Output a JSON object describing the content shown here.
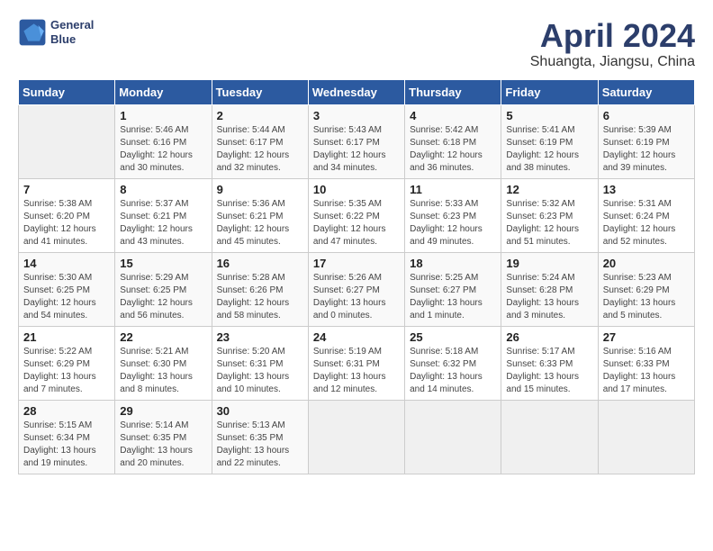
{
  "header": {
    "logo_line1": "General",
    "logo_line2": "Blue",
    "title": "April 2024",
    "subtitle": "Shuangta, Jiangsu, China"
  },
  "weekdays": [
    "Sunday",
    "Monday",
    "Tuesday",
    "Wednesday",
    "Thursday",
    "Friday",
    "Saturday"
  ],
  "weeks": [
    [
      {
        "day": "",
        "sunrise": "",
        "sunset": "",
        "daylight": ""
      },
      {
        "day": "1",
        "sunrise": "5:46 AM",
        "sunset": "6:16 PM",
        "daylight": "12 hours and 30 minutes."
      },
      {
        "day": "2",
        "sunrise": "5:44 AM",
        "sunset": "6:17 PM",
        "daylight": "12 hours and 32 minutes."
      },
      {
        "day": "3",
        "sunrise": "5:43 AM",
        "sunset": "6:17 PM",
        "daylight": "12 hours and 34 minutes."
      },
      {
        "day": "4",
        "sunrise": "5:42 AM",
        "sunset": "6:18 PM",
        "daylight": "12 hours and 36 minutes."
      },
      {
        "day": "5",
        "sunrise": "5:41 AM",
        "sunset": "6:19 PM",
        "daylight": "12 hours and 38 minutes."
      },
      {
        "day": "6",
        "sunrise": "5:39 AM",
        "sunset": "6:19 PM",
        "daylight": "12 hours and 39 minutes."
      }
    ],
    [
      {
        "day": "7",
        "sunrise": "5:38 AM",
        "sunset": "6:20 PM",
        "daylight": "12 hours and 41 minutes."
      },
      {
        "day": "8",
        "sunrise": "5:37 AM",
        "sunset": "6:21 PM",
        "daylight": "12 hours and 43 minutes."
      },
      {
        "day": "9",
        "sunrise": "5:36 AM",
        "sunset": "6:21 PM",
        "daylight": "12 hours and 45 minutes."
      },
      {
        "day": "10",
        "sunrise": "5:35 AM",
        "sunset": "6:22 PM",
        "daylight": "12 hours and 47 minutes."
      },
      {
        "day": "11",
        "sunrise": "5:33 AM",
        "sunset": "6:23 PM",
        "daylight": "12 hours and 49 minutes."
      },
      {
        "day": "12",
        "sunrise": "5:32 AM",
        "sunset": "6:23 PM",
        "daylight": "12 hours and 51 minutes."
      },
      {
        "day": "13",
        "sunrise": "5:31 AM",
        "sunset": "6:24 PM",
        "daylight": "12 hours and 52 minutes."
      }
    ],
    [
      {
        "day": "14",
        "sunrise": "5:30 AM",
        "sunset": "6:25 PM",
        "daylight": "12 hours and 54 minutes."
      },
      {
        "day": "15",
        "sunrise": "5:29 AM",
        "sunset": "6:25 PM",
        "daylight": "12 hours and 56 minutes."
      },
      {
        "day": "16",
        "sunrise": "5:28 AM",
        "sunset": "6:26 PM",
        "daylight": "12 hours and 58 minutes."
      },
      {
        "day": "17",
        "sunrise": "5:26 AM",
        "sunset": "6:27 PM",
        "daylight": "13 hours and 0 minutes."
      },
      {
        "day": "18",
        "sunrise": "5:25 AM",
        "sunset": "6:27 PM",
        "daylight": "13 hours and 1 minute."
      },
      {
        "day": "19",
        "sunrise": "5:24 AM",
        "sunset": "6:28 PM",
        "daylight": "13 hours and 3 minutes."
      },
      {
        "day": "20",
        "sunrise": "5:23 AM",
        "sunset": "6:29 PM",
        "daylight": "13 hours and 5 minutes."
      }
    ],
    [
      {
        "day": "21",
        "sunrise": "5:22 AM",
        "sunset": "6:29 PM",
        "daylight": "13 hours and 7 minutes."
      },
      {
        "day": "22",
        "sunrise": "5:21 AM",
        "sunset": "6:30 PM",
        "daylight": "13 hours and 8 minutes."
      },
      {
        "day": "23",
        "sunrise": "5:20 AM",
        "sunset": "6:31 PM",
        "daylight": "13 hours and 10 minutes."
      },
      {
        "day": "24",
        "sunrise": "5:19 AM",
        "sunset": "6:31 PM",
        "daylight": "13 hours and 12 minutes."
      },
      {
        "day": "25",
        "sunrise": "5:18 AM",
        "sunset": "6:32 PM",
        "daylight": "13 hours and 14 minutes."
      },
      {
        "day": "26",
        "sunrise": "5:17 AM",
        "sunset": "6:33 PM",
        "daylight": "13 hours and 15 minutes."
      },
      {
        "day": "27",
        "sunrise": "5:16 AM",
        "sunset": "6:33 PM",
        "daylight": "13 hours and 17 minutes."
      }
    ],
    [
      {
        "day": "28",
        "sunrise": "5:15 AM",
        "sunset": "6:34 PM",
        "daylight": "13 hours and 19 minutes."
      },
      {
        "day": "29",
        "sunrise": "5:14 AM",
        "sunset": "6:35 PM",
        "daylight": "13 hours and 20 minutes."
      },
      {
        "day": "30",
        "sunrise": "5:13 AM",
        "sunset": "6:35 PM",
        "daylight": "13 hours and 22 minutes."
      },
      {
        "day": "",
        "sunrise": "",
        "sunset": "",
        "daylight": ""
      },
      {
        "day": "",
        "sunrise": "",
        "sunset": "",
        "daylight": ""
      },
      {
        "day": "",
        "sunrise": "",
        "sunset": "",
        "daylight": ""
      },
      {
        "day": "",
        "sunrise": "",
        "sunset": "",
        "daylight": ""
      }
    ]
  ]
}
